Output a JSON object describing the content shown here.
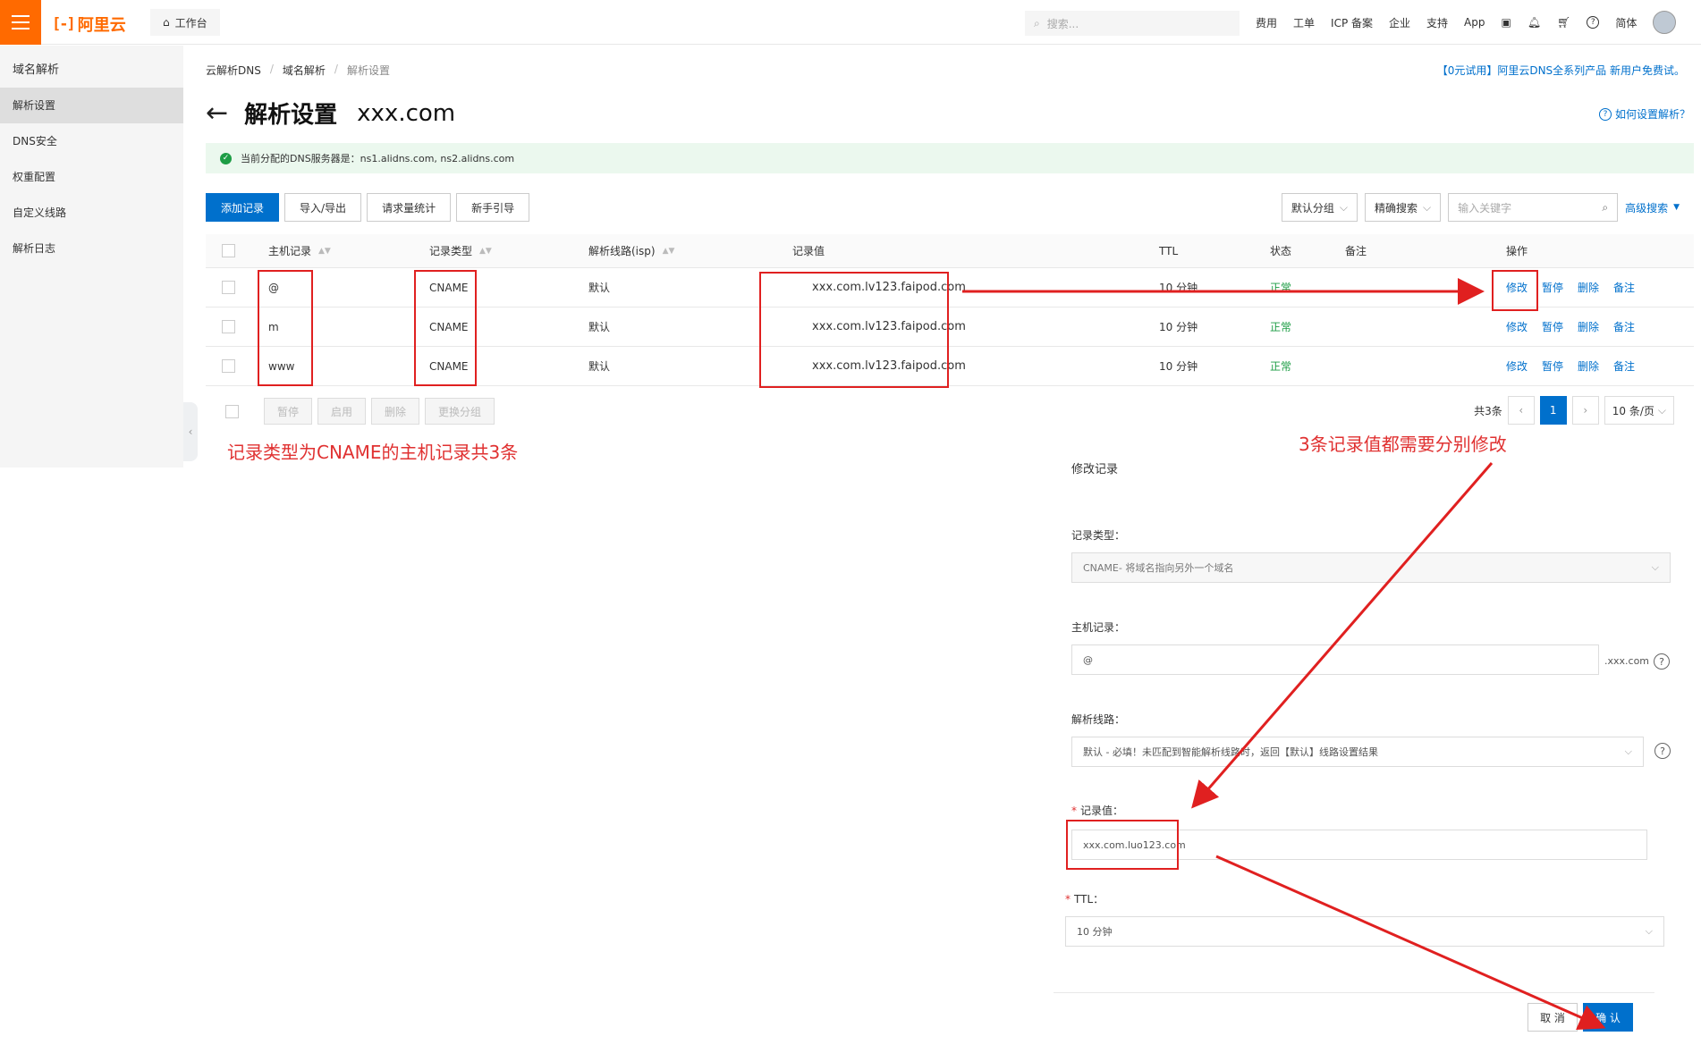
{
  "topbar": {
    "brand": "阿里云",
    "workspace": "工作台",
    "search_placeholder": "搜索...",
    "nav": [
      "费用",
      "工单",
      "ICP 备案",
      "企业",
      "支持",
      "App"
    ],
    "lang": "简体"
  },
  "sidebar": {
    "title": "域名解析",
    "items": [
      "解析设置",
      "DNS安全",
      "权重配置",
      "自定义线路",
      "解析日志"
    ],
    "active_index": 0
  },
  "breadcrumb": [
    "云解析DNS",
    "域名解析",
    "解析设置"
  ],
  "promo": "【0元试用】阿里云DNS全系列产品 新用户免费试。",
  "page": {
    "title": "解析设置",
    "domain": "xxx.com",
    "help": "如何设置解析？"
  },
  "notice": "当前分配的DNS服务器是：ns1.alidns.com, ns2.alidns.com",
  "toolbar": {
    "add": "添加记录",
    "import": "导入/导出",
    "stats": "请求量统计",
    "guide": "新手引导"
  },
  "filters": {
    "group": "默认分组",
    "mode": "精确搜索",
    "keyword_placeholder": "输入关键字",
    "advanced": "高级搜索"
  },
  "table": {
    "columns": [
      "主机记录",
      "记录类型",
      "解析线路(isp)",
      "记录值",
      "TTL",
      "状态",
      "备注",
      "操作"
    ],
    "rows": [
      {
        "host": "@",
        "type": "CNAME",
        "line": "默认",
        "value": "xxx.com.lv123.faipod.com",
        "ttl": "10 分钟",
        "status": "正常",
        "note": ""
      },
      {
        "host": "m",
        "type": "CNAME",
        "line": "默认",
        "value": "xxx.com.lv123.faipod.com",
        "ttl": "10 分钟",
        "status": "正常",
        "note": ""
      },
      {
        "host": "www",
        "type": "CNAME",
        "line": "默认",
        "value": "xxx.com.lv123.faipod.com",
        "ttl": "10 分钟",
        "status": "正常",
        "note": ""
      }
    ],
    "actions": [
      "修改",
      "暂停",
      "删除",
      "备注"
    ]
  },
  "bulk": [
    "暂停",
    "启用",
    "删除",
    "更换分组"
  ],
  "pager": {
    "total": "共3条",
    "current": "1",
    "size": "10 条/页"
  },
  "annotations": {
    "left": "记录类型为CNAME的主机记录共3条",
    "right": "3条记录值都需要分别修改"
  },
  "edit": {
    "title": "修改记录",
    "type_label": "记录类型：",
    "type_value": "CNAME- 将域名指向另外一个域名",
    "host_label": "主机记录：",
    "host_value": "@",
    "host_suffix": ".xxx.com",
    "line_label": "解析线路：",
    "line_value": "默认 - 必填！未匹配到智能解析线路时，返回【默认】线路设置结果",
    "value_label": "记录值：",
    "value_value": "xxx.com.luo123.com",
    "ttl_label": "TTL：",
    "ttl_value": "10 分钟",
    "cancel": "取 消",
    "confirm": "确 认"
  },
  "colors": {
    "brand": "#ff6a00",
    "primary": "#0070cc",
    "success": "#1d9d45",
    "annotation": "#e02020"
  }
}
